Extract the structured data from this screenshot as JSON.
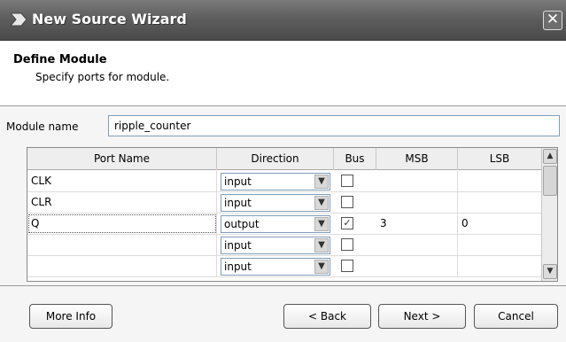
{
  "window": {
    "title": "New Source Wizard",
    "close_glyph": "✕"
  },
  "header": {
    "title": "Define Module",
    "subtitle": "Specify ports for module."
  },
  "module": {
    "label": "Module name",
    "value": "ripple_counter"
  },
  "table": {
    "columns": [
      "Port Name",
      "Direction",
      "Bus",
      "MSB",
      "LSB"
    ],
    "rows": [
      {
        "name": "CLK",
        "direction": "input",
        "bus": "",
        "msb": "",
        "lsb": ""
      },
      {
        "name": "CLR",
        "direction": "input",
        "bus": "",
        "msb": "",
        "lsb": ""
      },
      {
        "name": "Q",
        "direction": "output",
        "bus": "✓",
        "msb": "3",
        "lsb": "0"
      },
      {
        "name": "",
        "direction": "input",
        "bus": "",
        "msb": "",
        "lsb": ""
      },
      {
        "name": "",
        "direction": "input",
        "bus": "",
        "msb": "",
        "lsb": ""
      }
    ]
  },
  "icons": {
    "title": "wizard-arrow-icon",
    "dropdown": "chevron-down-icon",
    "scroll_up": "scroll-up-icon",
    "scroll_down": "scroll-down-icon"
  },
  "glyphs": {
    "dropdown": "▼",
    "scroll_up": "▲",
    "scroll_down": "▼"
  },
  "footer": {
    "more_info": "More Info",
    "back": "< Back",
    "next": "Next >",
    "cancel": "Cancel"
  }
}
